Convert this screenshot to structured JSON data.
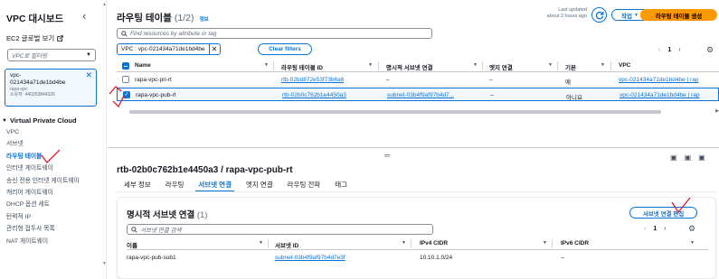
{
  "sidebar": {
    "title": "VPC 대시보드",
    "collapse_icon": "chevron-left-icon",
    "ec2_link": "EC2 글로벌 보기",
    "filter_placeholder": "VPC로 필터링",
    "vpc_card": {
      "line1": "vpc-",
      "line2": "021434a71de1bd4be",
      "line3": "rapa-vpc",
      "line4": "소유자: 440263844326"
    },
    "section_title": "Virtual Private Cloud",
    "items": [
      {
        "label": "VPC",
        "active": false
      },
      {
        "label": "서브넷",
        "active": false
      },
      {
        "label": "라우팅 테이블",
        "active": true
      },
      {
        "label": "인터넷 게이트웨이",
        "active": false
      },
      {
        "label": "송신 전용 인터넷 게이트웨이",
        "active": false
      },
      {
        "label": "캐리어 게이트웨이",
        "active": false
      },
      {
        "label": "DHCP 옵션 세트",
        "active": false
      },
      {
        "label": "탄력적 IP",
        "active": false
      },
      {
        "label": "관리형 접두사 목록",
        "active": false
      },
      {
        "label": "NAT 게이트웨이",
        "active": false
      }
    ]
  },
  "route_tables": {
    "title": "라우팅 테이블",
    "count": "(1/2)",
    "info": "정보",
    "last_updated_line1": "Last updated",
    "last_updated_line2": "about 2 hours ago",
    "actions_label": "작업",
    "create_label": "라우팅 테이블 생성",
    "search_placeholder": "Find resources by attribute or tag",
    "filter_token": "VPC : vpc-021434a71de1bd4be",
    "clear_filters": "Clear filters",
    "page": "1",
    "columns": [
      "Name",
      "라우팅 테이블 ID",
      "명시적 서브넷 연결",
      "엣지 연결",
      "기본",
      "VPC"
    ],
    "rows": [
      {
        "name": "rapa-vpc-pri-rt",
        "id": "rtb-02bd872e53f73b6a6",
        "subnet": "–",
        "edge": "–",
        "main": "예",
        "vpc": "vpc-021434a71de1bd4be | rap",
        "selected": false
      },
      {
        "name": "rapa-vpc-pub-rt",
        "id": "rtb-02b0c762b1e4450a3",
        "subnet": "subnet-03b4f9af97b4d7...",
        "edge": "–",
        "main": "아니요",
        "vpc": "vpc-021434a71de1bd4be | rap",
        "selected": true
      }
    ]
  },
  "detail": {
    "title": "rtb-02b0c762b1e4450a3 / rapa-vpc-pub-rt",
    "tabs": [
      {
        "label": "세부 정보",
        "active": false
      },
      {
        "label": "라우팅",
        "active": false
      },
      {
        "label": "서브넷 연결",
        "active": true
      },
      {
        "label": "엣지 연결",
        "active": false
      },
      {
        "label": "라우팅 전파",
        "active": false
      },
      {
        "label": "태그",
        "active": false
      }
    ],
    "subnet_assoc": {
      "title": "명시적 서브넷 연결",
      "count": "(1)",
      "edit_label": "서브넷 연결 편집",
      "search_placeholder": "서브넷 연결 검색",
      "page": "1",
      "columns": [
        "이름",
        "서브넷 ID",
        "IPv4 CIDR",
        "IPv6 CIDR"
      ],
      "rows": [
        {
          "name": "rapa-vpc-pub-sub1",
          "subnet_id": "subnet-03b4f9af97b4d7e3f",
          "ipv4": "10.10.1.0/24",
          "ipv6": "–"
        }
      ]
    }
  },
  "colors": {
    "accent": "#0972d3",
    "primary_button": "#ff9900",
    "annotation": "#e0192b"
  }
}
